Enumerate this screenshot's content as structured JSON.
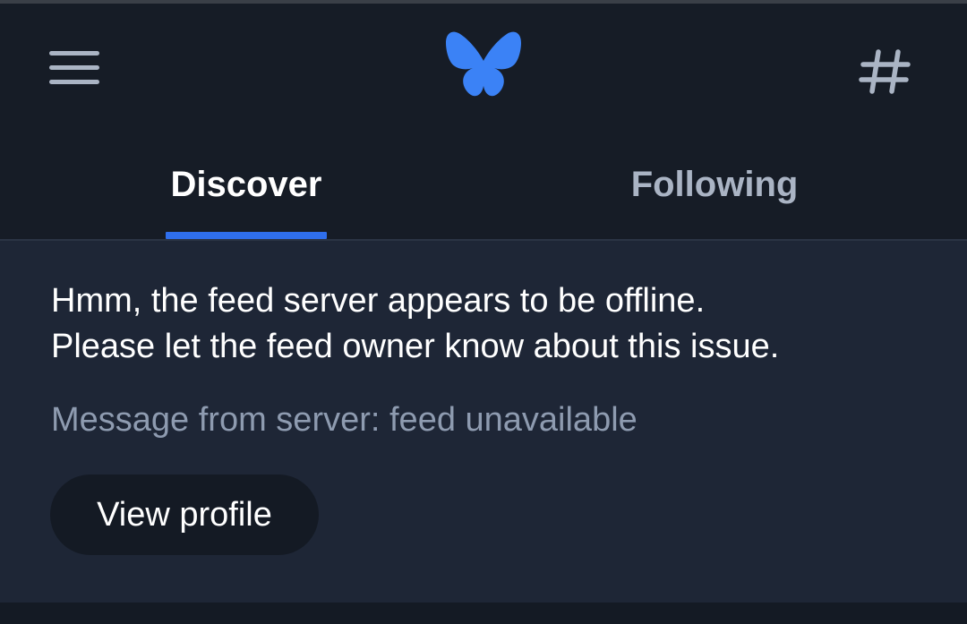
{
  "header": {
    "menu_icon": "hamburger-menu-icon",
    "logo_icon": "butterfly-logo-icon",
    "feeds_icon": "hashtag-icon",
    "brand_color": "#3b82f6"
  },
  "tabs": [
    {
      "label": "Discover",
      "active": true
    },
    {
      "label": "Following",
      "active": false
    }
  ],
  "feed_error": {
    "line1": "Hmm, the feed server appears to be offline.",
    "line2": "Please let the feed owner know about this issue.",
    "server_message": "Message from server: feed unavailable",
    "button_label": "View profile"
  },
  "colors": {
    "background": "#161c26",
    "panel": "#1e2636",
    "accent": "#2f6fed",
    "muted_text": "#8e9bb0"
  }
}
